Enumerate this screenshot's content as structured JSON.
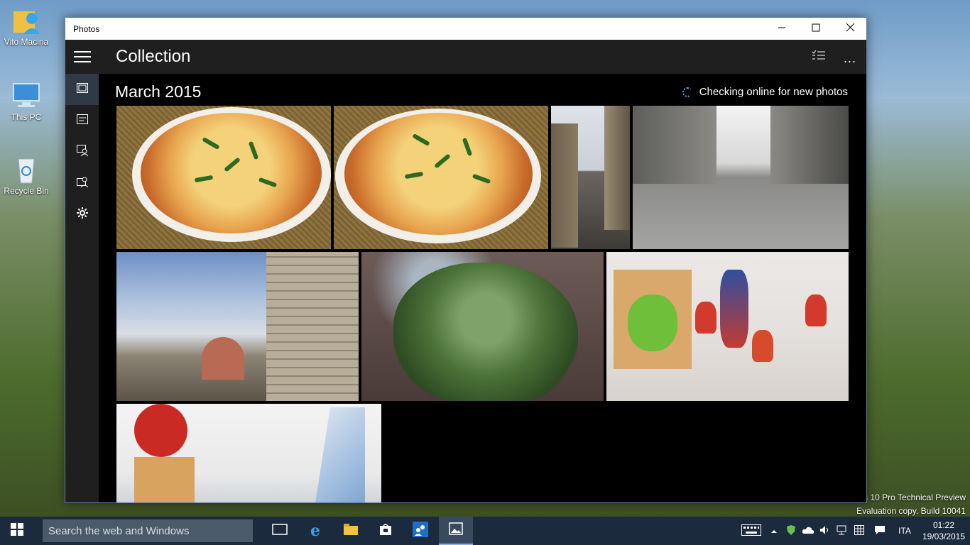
{
  "desktop": {
    "icons": [
      {
        "label": "Vito Macina",
        "icon": "user-folder-icon"
      },
      {
        "label": "This PC",
        "icon": "computer-icon"
      },
      {
        "label": "Recycle Bin",
        "icon": "recycle-bin-icon"
      }
    ],
    "watermark_line1": "s 10 Pro Technical Preview",
    "watermark_line2": "Evaluation copy. Build 10041"
  },
  "window": {
    "title": "Photos",
    "controls": [
      "minimize-icon",
      "maximize-icon",
      "close-icon"
    ]
  },
  "header": {
    "title": "Collection",
    "select_icon": "select-icon",
    "more_icon": "more-icon",
    "more_label": "..."
  },
  "sidebar": {
    "items": [
      {
        "name": "collection",
        "icon": "collection-icon",
        "active": true
      },
      {
        "name": "albums",
        "icon": "albums-icon",
        "active": false
      },
      {
        "name": "people",
        "icon": "people-icon",
        "active": false
      },
      {
        "name": "import",
        "icon": "import-icon",
        "active": false
      },
      {
        "name": "settings",
        "icon": "settings-gear-icon",
        "active": false
      }
    ]
  },
  "content": {
    "month_heading": "March 2015",
    "status_text": "Checking online for new photos",
    "photos": [
      {
        "subject": "pizza"
      },
      {
        "subject": "pizza"
      },
      {
        "subject": "street"
      },
      {
        "subject": "street"
      },
      {
        "subject": "street with building"
      },
      {
        "subject": "cactus"
      },
      {
        "subject": "toys"
      },
      {
        "subject": "toys shelf"
      }
    ]
  },
  "taskbar": {
    "search_placeholder": "Search the web and Windows",
    "apps": [
      "task-view-icon",
      "internet-explorer-icon",
      "file-explorer-icon",
      "store-icon",
      "people-app-icon",
      "photos-app-icon"
    ],
    "active_app": "photos-app-icon",
    "language": "ITA",
    "time": "01:22",
    "date": "19/03/2015"
  },
  "colors": {
    "accent": "#1f6fc4",
    "app_header_bg": "#1f1f1f",
    "content_bg": "#000000",
    "taskbar_bg": "#1b2a3c"
  }
}
